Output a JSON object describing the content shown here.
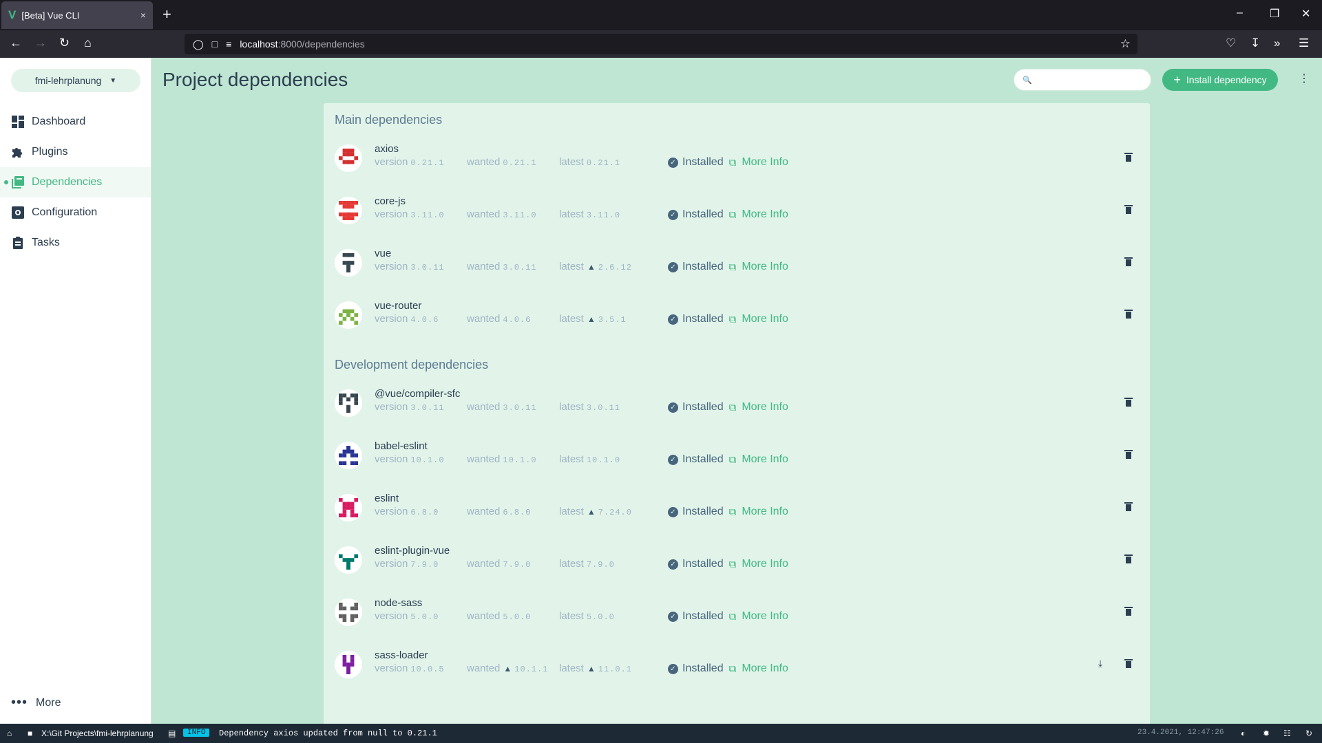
{
  "browser": {
    "tab_title": "[Beta] Vue CLI",
    "tab_close": "×",
    "new_tab": "+",
    "url_host": "localhost",
    "url_path": ":8000/dependencies"
  },
  "sidebar": {
    "project_name": "fmi-lehrplanung",
    "items": [
      {
        "label": "Dashboard",
        "icon": "dashboard-icon"
      },
      {
        "label": "Plugins",
        "icon": "puzzle-icon"
      },
      {
        "label": "Dependencies",
        "icon": "library-icon",
        "active": true
      },
      {
        "label": "Configuration",
        "icon": "settings-box-icon"
      },
      {
        "label": "Tasks",
        "icon": "clipboard-icon"
      }
    ],
    "more_label": "More"
  },
  "header": {
    "title": "Project dependencies",
    "search_placeholder": "",
    "install_label": "Install dependency"
  },
  "labels": {
    "version": "version",
    "wanted": "wanted",
    "latest": "latest",
    "installed": "Installed",
    "more_info": "More Info"
  },
  "sections": {
    "main": "Main dependencies",
    "dev": "Development dependencies"
  },
  "main_deps": [
    {
      "name": "axios",
      "version": "0.21.1",
      "wanted": "0.21.1",
      "latest": "0.21.1",
      "latest_warn": false,
      "wanted_warn": false,
      "color": "#d32f2f"
    },
    {
      "name": "core-js",
      "version": "3.11.0",
      "wanted": "3.11.0",
      "latest": "3.11.0",
      "latest_warn": false,
      "wanted_warn": false,
      "color": "#e53935"
    },
    {
      "name": "vue",
      "version": "3.0.11",
      "wanted": "3.0.11",
      "latest": "2.6.12",
      "latest_warn": true,
      "wanted_warn": false,
      "color": "#37474f"
    },
    {
      "name": "vue-router",
      "version": "4.0.6",
      "wanted": "4.0.6",
      "latest": "3.5.1",
      "latest_warn": true,
      "wanted_warn": false,
      "color": "#7cb342"
    }
  ],
  "dev_deps": [
    {
      "name": "@vue/compiler-sfc",
      "version": "3.0.11",
      "wanted": "3.0.11",
      "latest": "3.0.11",
      "latest_warn": false,
      "wanted_warn": false,
      "color": "#37474f"
    },
    {
      "name": "babel-eslint",
      "version": "10.1.0",
      "wanted": "10.1.0",
      "latest": "10.1.0",
      "latest_warn": false,
      "wanted_warn": false,
      "color": "#283593"
    },
    {
      "name": "eslint",
      "version": "6.8.0",
      "wanted": "6.8.0",
      "latest": "7.24.0",
      "latest_warn": true,
      "wanted_warn": false,
      "color": "#d81b60"
    },
    {
      "name": "eslint-plugin-vue",
      "version": "7.9.0",
      "wanted": "7.9.0",
      "latest": "7.9.0",
      "latest_warn": false,
      "wanted_warn": false,
      "color": "#00796b"
    },
    {
      "name": "node-sass",
      "version": "5.0.0",
      "wanted": "5.0.0",
      "latest": "5.0.0",
      "latest_warn": false,
      "wanted_warn": false,
      "color": "#616161"
    },
    {
      "name": "sass-loader",
      "version": "10.0.5",
      "wanted": "10.1.1",
      "latest": "11.0.1",
      "latest_warn": true,
      "wanted_warn": true,
      "color": "#7b1fa2",
      "update": true
    }
  ],
  "statusbar": {
    "path": "X:\\Git Projects\\fmi-lehrplanung",
    "level": "INFO",
    "message": "Dependency axios updated from null to 0.21.1",
    "time": "23.4.2021, 12:47:26"
  },
  "colors": {
    "accent": "#42b983",
    "main_bg": "#bfe6d3",
    "panel_bg": "#e2f4ea",
    "text": "#2c3e50"
  }
}
